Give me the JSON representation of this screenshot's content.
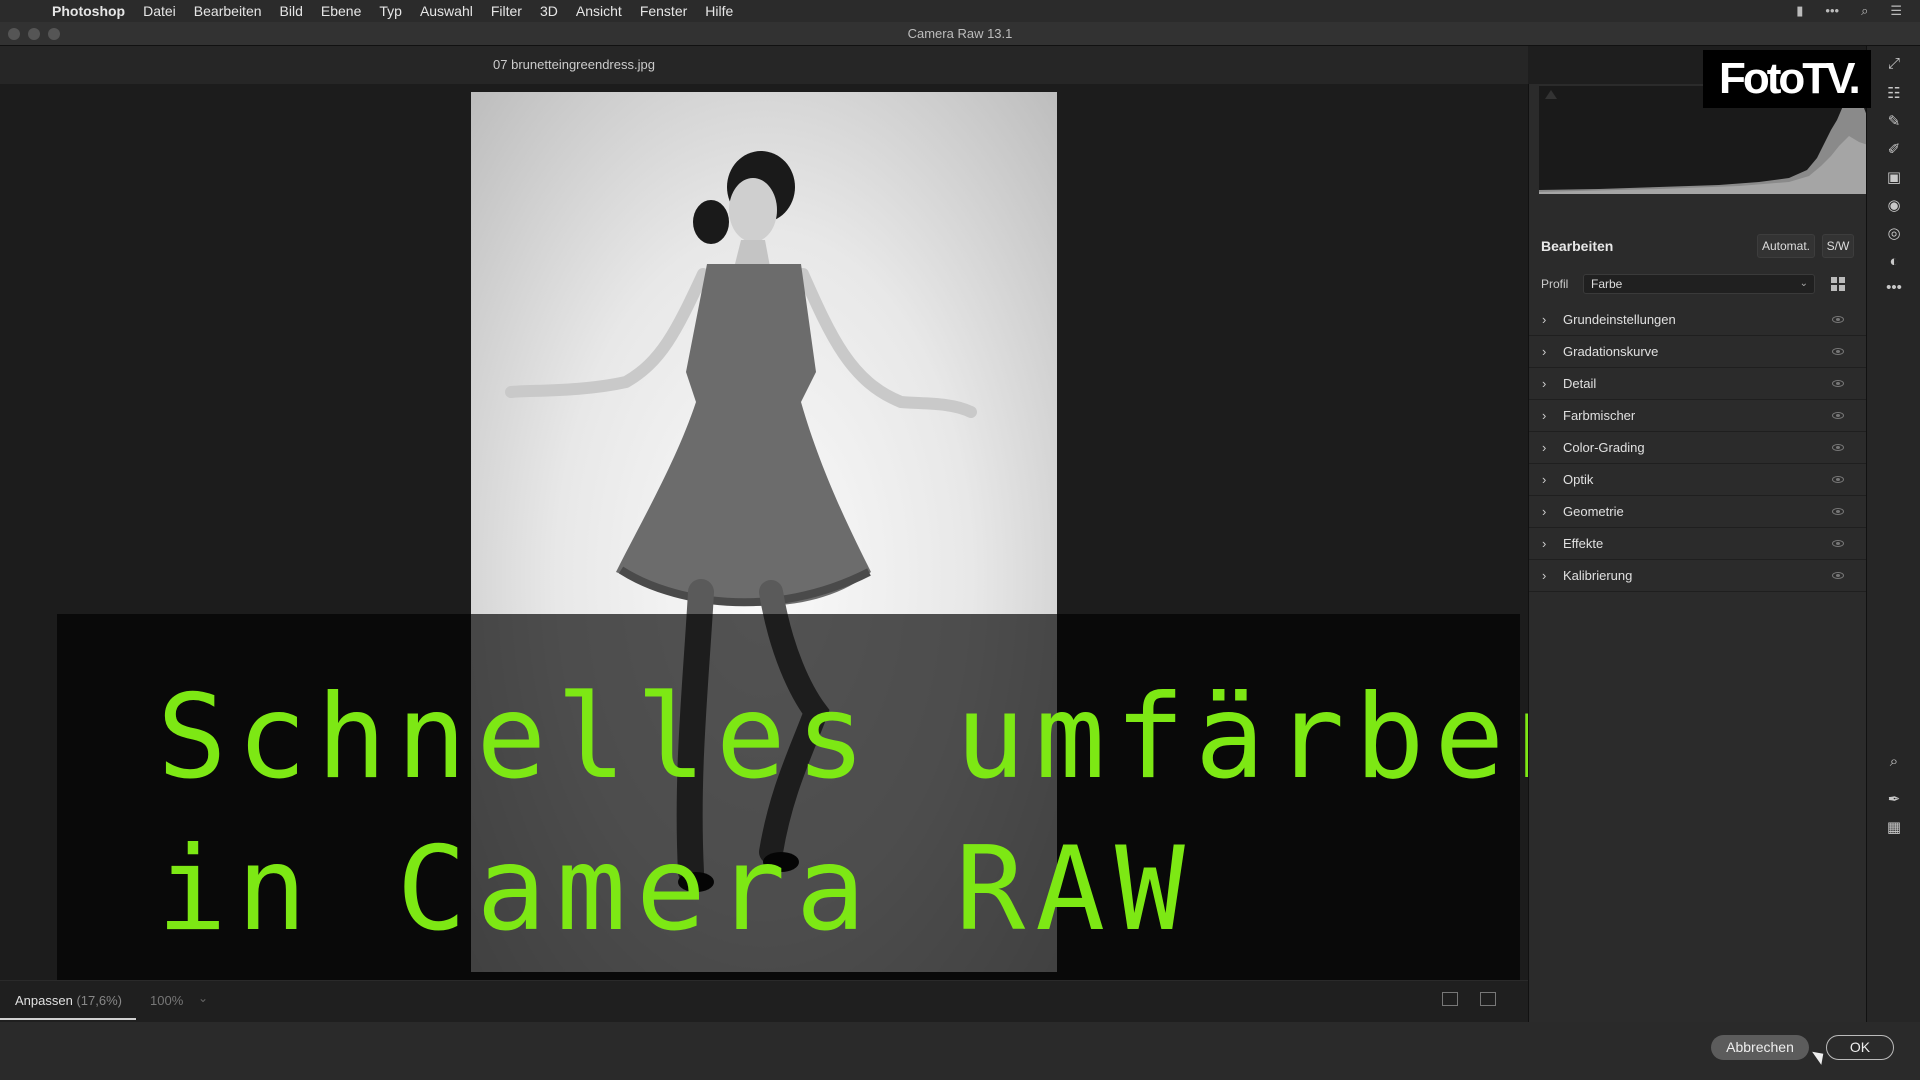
{
  "menubar": {
    "apple_icon": "apple-icon",
    "items": [
      "Photoshop",
      "Datei",
      "Bearbeiten",
      "Bild",
      "Ebene",
      "Typ",
      "Auswahl",
      "Filter",
      "3D",
      "Ansicht",
      "Fenster",
      "Hilfe"
    ],
    "right_icons": [
      "battery-icon",
      "more-icon",
      "search-icon",
      "list-icon"
    ]
  },
  "window": {
    "title": "Camera Raw 13.1"
  },
  "file": {
    "name": "07 brunetteingreendress.jpg"
  },
  "canvas": {
    "fit_label": "Anpassen",
    "fit_percent": "(17,6%)",
    "zoom_label": "100%"
  },
  "panel": {
    "title": "Bearbeiten",
    "auto_button": "Automat.",
    "bw_button": "S/W",
    "profile_label": "Profil",
    "profile_value": "Farbe",
    "sections": [
      "Grundeinstellungen",
      "Gradationskurve",
      "Detail",
      "Farbmischer",
      "Color-Grading",
      "Optik",
      "Geometrie",
      "Effekte",
      "Kalibrierung"
    ]
  },
  "buttons": {
    "cancel": "Abbrechen",
    "ok": "OK"
  },
  "logo": {
    "text": "FotoTV."
  },
  "caption": {
    "line1": "Schnelles umfärben",
    "line2": "in Camera RAW"
  },
  "colors": {
    "caption_green": "#7de814",
    "panel_bg": "#2b2b2b",
    "canvas_bg": "#1c1c1c"
  }
}
